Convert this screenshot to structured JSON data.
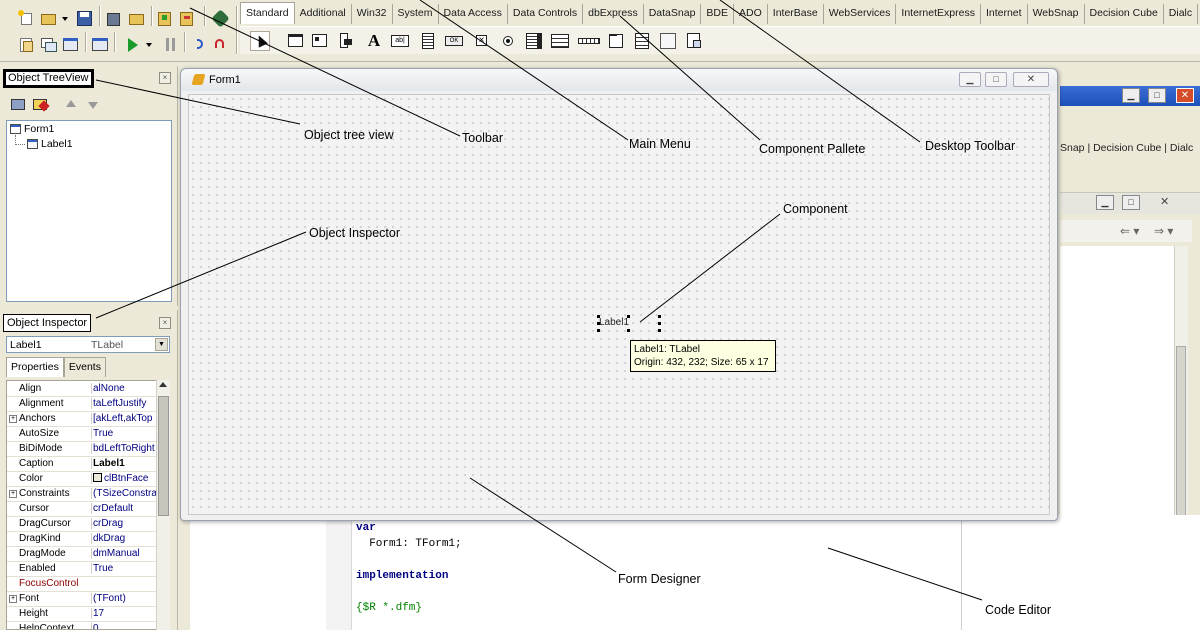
{
  "palette": {
    "tabs": [
      "Standard",
      "Additional",
      "Win32",
      "System",
      "Data Access",
      "Data Controls",
      "dbExpress",
      "DataSnap",
      "BDE",
      "ADO",
      "InterBase",
      "WebServices",
      "InternetExpress",
      "Internet",
      "WebSnap",
      "Decision Cube",
      "Dialc"
    ],
    "active_tab": "Standard"
  },
  "tree_view": {
    "title": "Object TreeView",
    "nodes": [
      "Form1",
      "Label1"
    ]
  },
  "inspector": {
    "title": "Object Inspector",
    "selected_object": "Label1",
    "selected_class": "TLabel",
    "tabs": [
      "Properties",
      "Events"
    ],
    "properties": [
      {
        "name": "Align",
        "value": "alNone"
      },
      {
        "name": "Alignment",
        "value": "taLeftJustify"
      },
      {
        "name": "Anchors",
        "value": "[akLeft,akTop"
      },
      {
        "name": "AutoSize",
        "value": "True"
      },
      {
        "name": "BiDiMode",
        "value": "bdLeftToRight"
      },
      {
        "name": "Caption",
        "value": "Label1"
      },
      {
        "name": "Color",
        "value": "clBtnFace"
      },
      {
        "name": "Constraints",
        "value": "(TSizeConstra"
      },
      {
        "name": "Cursor",
        "value": "crDefault"
      },
      {
        "name": "DragCursor",
        "value": "crDrag"
      },
      {
        "name": "DragKind",
        "value": "dkDrag"
      },
      {
        "name": "DragMode",
        "value": "dmManual"
      },
      {
        "name": "Enabled",
        "value": "True"
      },
      {
        "name": "FocusControl",
        "value": ""
      },
      {
        "name": "Font",
        "value": "(TFont)"
      },
      {
        "name": "Height",
        "value": "17"
      },
      {
        "name": "HelpContext",
        "value": "0"
      }
    ]
  },
  "form": {
    "title": "Form1",
    "label_caption": "Label1",
    "hint_line1": "Label1: TLabel",
    "hint_line2": "Origin: 432, 232; Size: 65 x 17"
  },
  "background_window": {
    "tab_fragment": "Snap | Decision Cube | Dialc"
  },
  "code": {
    "line1": "var",
    "line2": "  Form1: TForm1;",
    "line3": "implementation",
    "line4": "{$R *.dfm}"
  },
  "annotations": {
    "object_tree_view": "Object tree view",
    "toolbar": "Toolbar",
    "main_menu": "Main Menu",
    "component_pallete": "Component Pallete",
    "desktop_toolbar": "Desktop Toolbar",
    "component": "Component",
    "object_inspector": "Object Inspector",
    "form_designer": "Form Designer",
    "code_editor": "Code Editor"
  }
}
